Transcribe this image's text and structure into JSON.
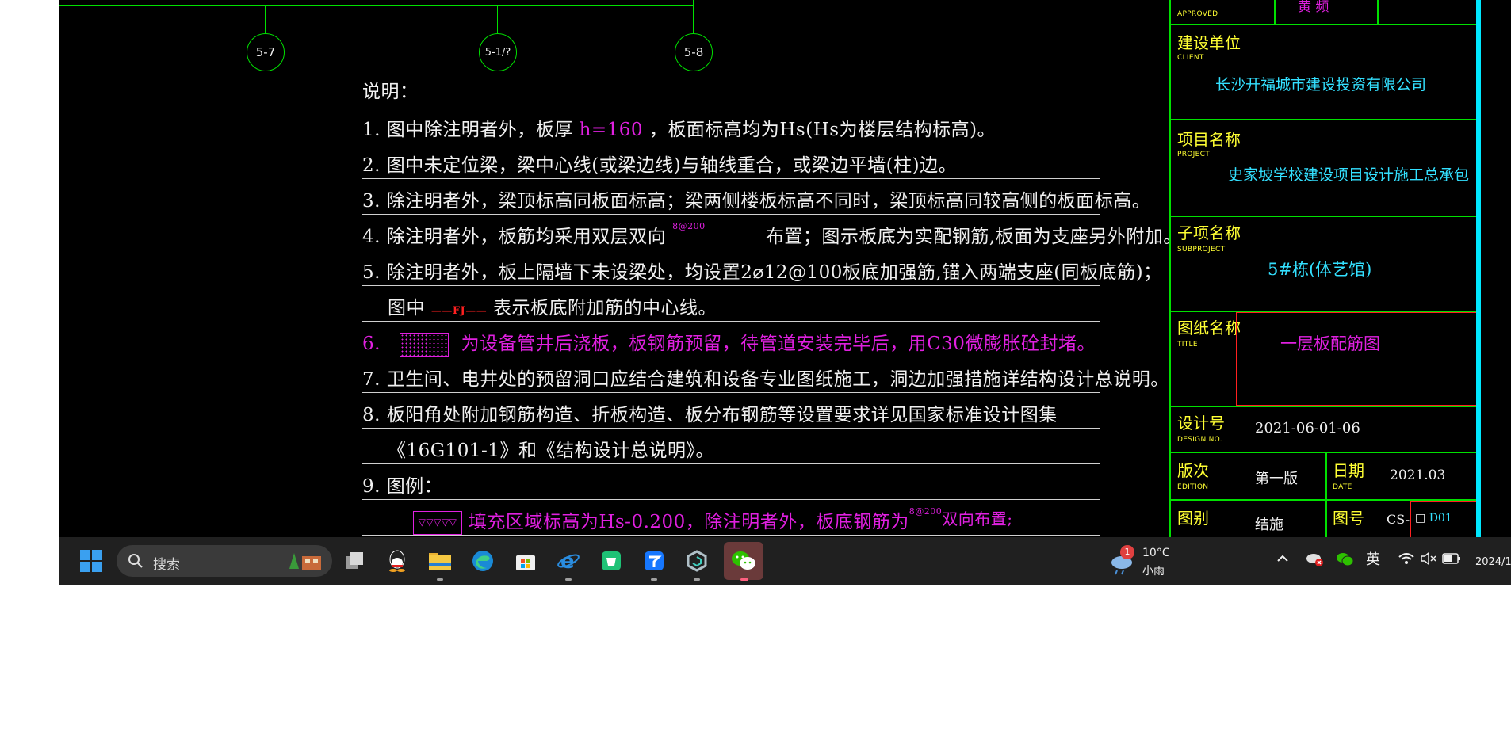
{
  "axes": [
    {
      "label": "5-7"
    },
    {
      "label": "5-1/?"
    },
    {
      "label": "5-8"
    }
  ],
  "notes": {
    "heading": "说明：",
    "n1_a": "1. 图中除注明者外，板厚",
    "n1_h": "h=160",
    "n1_b": "，板面标高均为Hs(Hs为楼层结构标高)。",
    "n2": "2. 图中未定位梁，梁中心线(或梁边线)与轴线重合，或梁边平墙(柱)边。",
    "n3": "3. 除注明者外，梁顶标高同板面标高；梁两侧楼板标高不同时，梁顶标高同较高侧的板面标高。",
    "n4_a": "4. 除注明者外，板筋均采用双层双向",
    "n4_small": "8@200",
    "n4_b": "布置；图示板底为实配钢筋,板面为支座另外附加。",
    "n5": "5. 除注明者外，板上隔墙下未设梁处，均设置2⌀12@100板底加强筋,锚入两端支座(同板底筋)；",
    "n5b_a": "图中",
    "n5b_fj": "——FJ——",
    "n5b_b": "表示板底附加筋的中心线。",
    "n6_num": "6.",
    "n6": "为设备管井后浇板，板钢筋预留，待管道安装完毕后，用C30微膨胀砼封堵。",
    "n7": "7. 卫生间、电井处的预留洞口应结合建筑和设备专业图纸施工，洞边加强措施详结构设计总说明。",
    "n8": "8. 板阳角处附加钢筋构造、折板构造、板分布钢筋等设置要求详见国家标准设计图集",
    "n8b": "《16G101-1》和《结构设计总说明》。",
    "n9": "9. 图例：",
    "n9_tri": "▽▽▽▽▽",
    "n9_text": "填充区域标高为Hs-0.200，除注明者外，板底钢筋为",
    "n9_small": "8@200",
    "n9_end": "双向布置;"
  },
  "titleblock": {
    "approved_en": "APPROVED",
    "approved_val": "黄  频",
    "client_cn": "建设单位",
    "client_en": "CLIENT",
    "client_val": "长沙开福城市建设投资有限公司",
    "project_cn": "项目名称",
    "project_en": "PROJECT",
    "project_val": "史家坡学校建设项目设计施工总承包",
    "subproject_cn": "子项名称",
    "subproject_en": "SUBPROJECT",
    "subproject_val": "5#栋(体艺馆)",
    "title_cn": "图纸名称",
    "title_en": "TITLE",
    "title_val": "一层板配筋图",
    "designno_cn": "设计号",
    "designno_en": "DESIGN NO.",
    "designno_val": "2021-06-01-06",
    "edition_cn": "版次",
    "edition_en": "EDITION",
    "edition_val": "第一版",
    "date_cn": "日期",
    "date_en": "DATE",
    "date_val": "2021.03",
    "drawtype_cn": "图别",
    "drawtype_val": "结施",
    "drawno_cn": "图号",
    "drawno_val": "CS-",
    "drawno_suffix": "D01"
  },
  "taskbar": {
    "search_placeholder": "搜索",
    "weather_temp": "10°C",
    "weather_desc": "小雨",
    "weather_badge": "1",
    "ime": "英",
    "clock": "2024/1",
    "icons": [
      "windows-start-icon",
      "search-icon",
      "task-view-icon",
      "qq-icon",
      "file-explorer-icon",
      "edge-icon",
      "microsoft-store-icon",
      "ie-icon",
      "green-app-icon",
      "blue-app-icon",
      "gray-app-icon",
      "wechat-icon"
    ]
  }
}
